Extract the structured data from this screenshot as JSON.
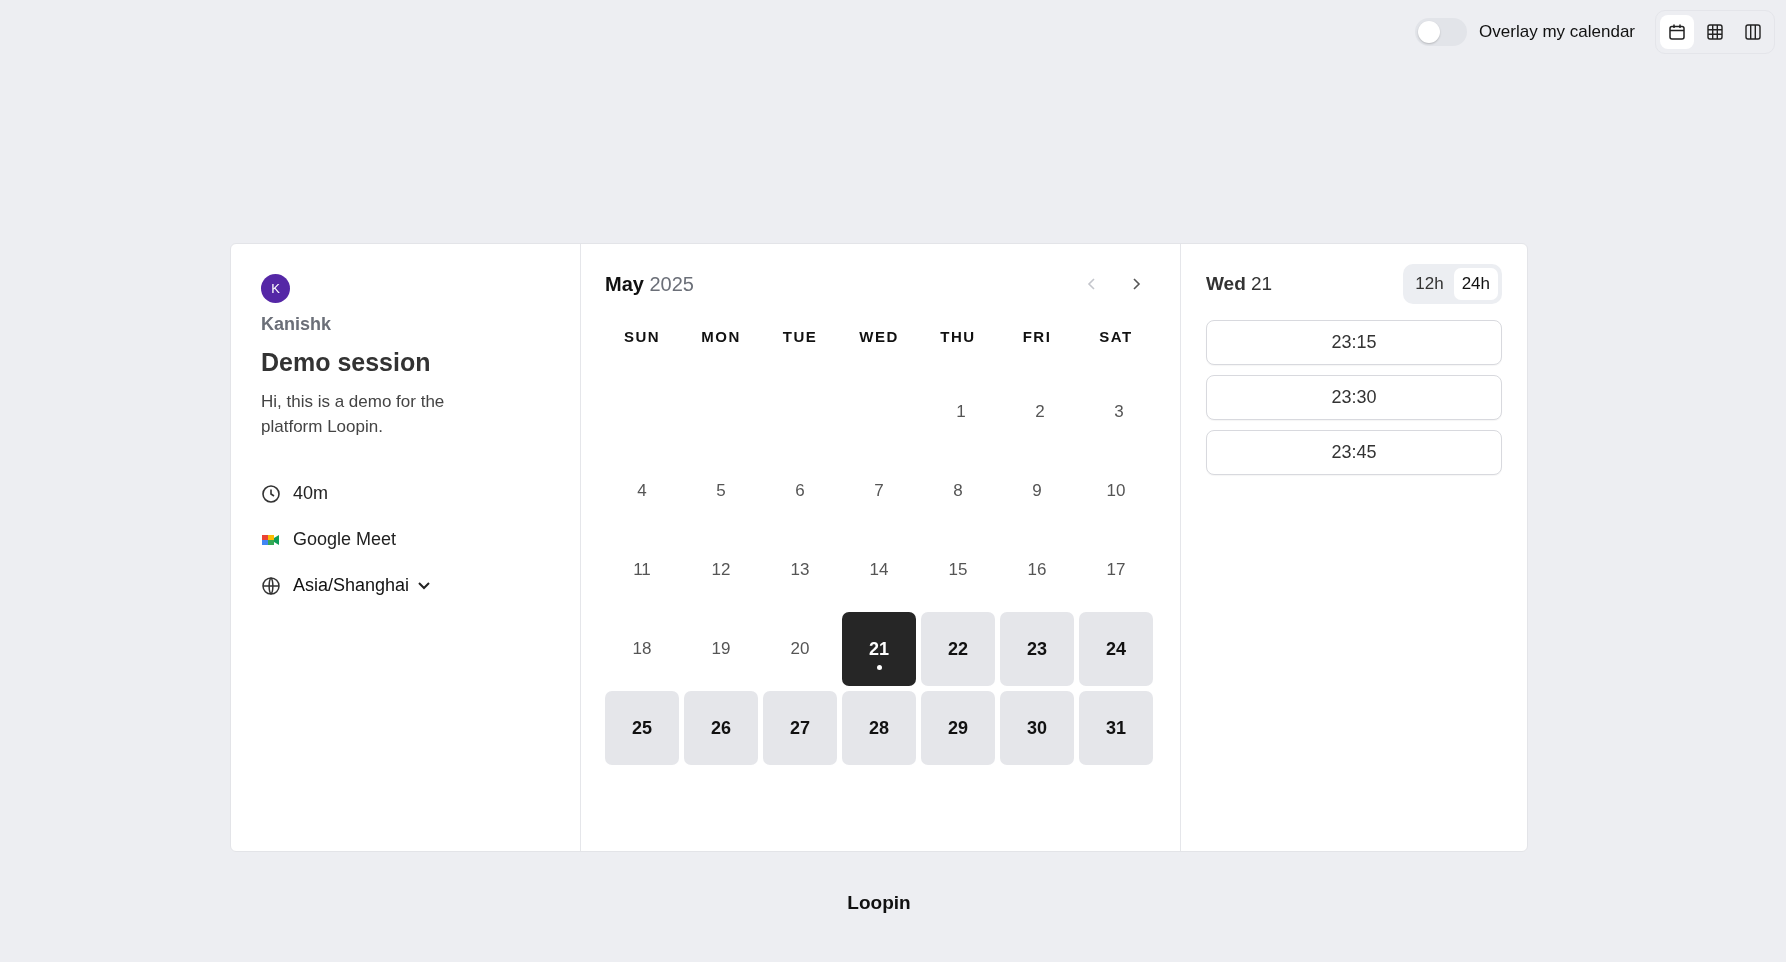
{
  "topbar": {
    "overlay_toggle": {
      "label": "Overlay my calendar",
      "on": false
    },
    "views": [
      {
        "kind": "month",
        "selected": true
      },
      {
        "kind": "week",
        "selected": false
      },
      {
        "kind": "column",
        "selected": false
      }
    ]
  },
  "event": {
    "avatar_initial": "K",
    "host": "Kanishk",
    "title": "Demo session",
    "description": "Hi, this is a demo for the platform Loopin.",
    "duration": "40m",
    "location": "Google Meet",
    "timezone": "Asia/Shanghai"
  },
  "calendar": {
    "month": "May",
    "year": "2025",
    "weekdays": [
      "SUN",
      "MON",
      "TUE",
      "WED",
      "THU",
      "FRI",
      "SAT"
    ],
    "weeks": [
      [
        {
          "day": "1",
          "available": false,
          "selected": false,
          "today": false
        },
        {
          "day": "2",
          "available": false,
          "selected": false,
          "today": false
        },
        {
          "day": "3",
          "available": false,
          "selected": false,
          "today": false
        }
      ],
      [
        {
          "day": "4",
          "available": false,
          "selected": false,
          "today": false
        },
        {
          "day": "5",
          "available": false,
          "selected": false,
          "today": false
        },
        {
          "day": "6",
          "available": false,
          "selected": false,
          "today": false
        },
        {
          "day": "7",
          "available": false,
          "selected": false,
          "today": false
        },
        {
          "day": "8",
          "available": false,
          "selected": false,
          "today": false
        },
        {
          "day": "9",
          "available": false,
          "selected": false,
          "today": false
        },
        {
          "day": "10",
          "available": false,
          "selected": false,
          "today": false
        }
      ],
      [
        {
          "day": "11",
          "available": false,
          "selected": false,
          "today": false
        },
        {
          "day": "12",
          "available": false,
          "selected": false,
          "today": false
        },
        {
          "day": "13",
          "available": false,
          "selected": false,
          "today": false
        },
        {
          "day": "14",
          "available": false,
          "selected": false,
          "today": false
        },
        {
          "day": "15",
          "available": false,
          "selected": false,
          "today": false
        },
        {
          "day": "16",
          "available": false,
          "selected": false,
          "today": false
        },
        {
          "day": "17",
          "available": false,
          "selected": false,
          "today": false
        }
      ],
      [
        {
          "day": "18",
          "available": false,
          "selected": false,
          "today": false
        },
        {
          "day": "19",
          "available": false,
          "selected": false,
          "today": false
        },
        {
          "day": "20",
          "available": false,
          "selected": false,
          "today": false
        },
        {
          "day": "21",
          "available": true,
          "selected": true,
          "today": true
        },
        {
          "day": "22",
          "available": true,
          "selected": false,
          "today": false
        },
        {
          "day": "23",
          "available": true,
          "selected": false,
          "today": false
        },
        {
          "day": "24",
          "available": true,
          "selected": false,
          "today": false
        }
      ],
      [
        {
          "day": "25",
          "available": true,
          "selected": false,
          "today": false
        },
        {
          "day": "26",
          "available": true,
          "selected": false,
          "today": false
        },
        {
          "day": "27",
          "available": true,
          "selected": false,
          "today": false
        },
        {
          "day": "28",
          "available": true,
          "selected": false,
          "today": false
        },
        {
          "day": "29",
          "available": true,
          "selected": false,
          "today": false
        },
        {
          "day": "30",
          "available": true,
          "selected": false,
          "today": false
        },
        {
          "day": "31",
          "available": true,
          "selected": false,
          "today": false
        }
      ]
    ],
    "prev_disabled": true
  },
  "slots": {
    "weekday": "Wed",
    "day": "21",
    "formats": [
      {
        "label": "12h",
        "selected": false
      },
      {
        "label": "24h",
        "selected": true
      }
    ],
    "times": [
      "23:15",
      "23:30",
      "23:45"
    ]
  },
  "footer": {
    "brand": "Loopin"
  }
}
